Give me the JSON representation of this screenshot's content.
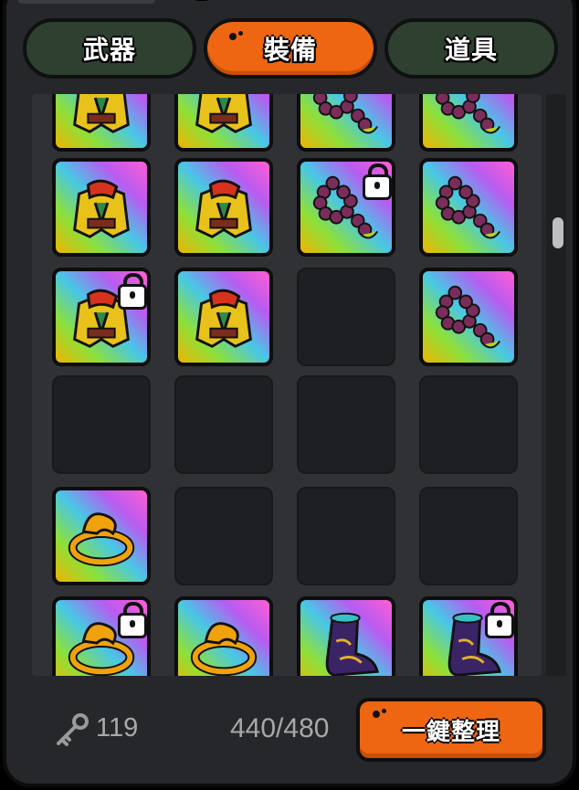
{
  "tabs": [
    {
      "label": "武器",
      "active": false
    },
    {
      "label": "裝備",
      "active": true
    },
    {
      "label": "道具",
      "active": false
    }
  ],
  "inventory": {
    "rows": [
      [
        {
          "item": "armor",
          "locked": false
        },
        {
          "item": "armor",
          "locked": false
        },
        {
          "item": "beads",
          "locked": false
        },
        {
          "item": "beads",
          "locked": false
        }
      ],
      [
        {
          "item": "armor",
          "locked": false
        },
        {
          "item": "armor",
          "locked": false
        },
        {
          "item": "beads",
          "locked": true
        },
        {
          "item": "beads",
          "locked": false
        }
      ],
      [
        {
          "item": "armor",
          "locked": true
        },
        {
          "item": "armor",
          "locked": false
        },
        {
          "item": "empty",
          "locked": false
        },
        {
          "item": "beads",
          "locked": false
        }
      ],
      [
        {
          "item": "empty",
          "locked": false
        },
        {
          "item": "empty",
          "locked": false
        },
        {
          "item": "empty",
          "locked": false
        },
        {
          "item": "empty",
          "locked": false
        }
      ],
      [
        {
          "item": "ring",
          "locked": false
        },
        {
          "item": "empty",
          "locked": false
        },
        {
          "item": "empty",
          "locked": false
        },
        {
          "item": "empty",
          "locked": false
        }
      ],
      [
        {
          "item": "ring",
          "locked": true
        },
        {
          "item": "ring",
          "locked": false
        },
        {
          "item": "boots",
          "locked": false
        },
        {
          "item": "boots",
          "locked": true
        }
      ]
    ]
  },
  "footer": {
    "key_icon": "key-icon",
    "key_count": "119",
    "capacity": "440/480",
    "sort_label": "一鍵整理"
  },
  "colors": {
    "accent": "#ee6612",
    "panel": "#25272a",
    "tab_inactive": "#2e4030"
  }
}
